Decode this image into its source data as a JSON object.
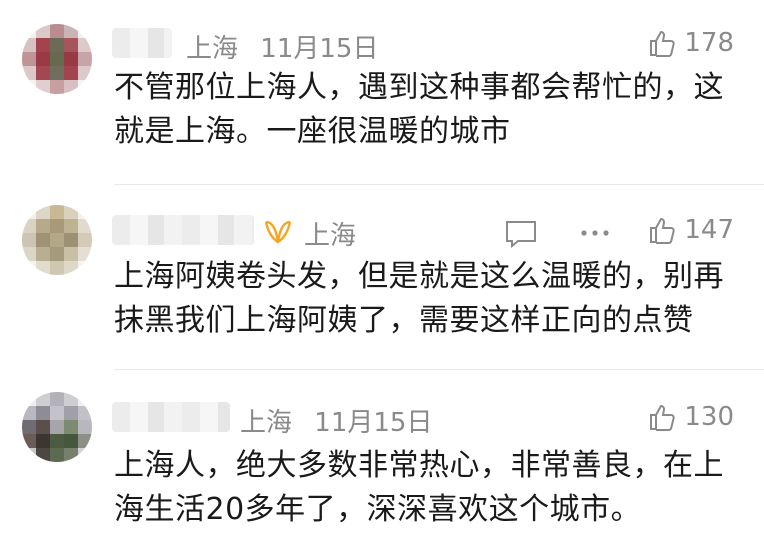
{
  "comments": [
    {
      "location": "上海",
      "date": "11月15日",
      "likes": "178",
      "lines": [
        "不管那位上海人，遇到这种事都会帮忙的，这",
        "就是上海。一座很温暖的城市"
      ]
    },
    {
      "location": "上海",
      "date": "",
      "likes": "147",
      "lines": [
        "上海阿姨卷头发，但是就是这么温暖的，别再",
        "抹黑我们上海阿姨了，需要这样正向的点赞"
      ]
    },
    {
      "location": "上海",
      "date": "11月15日",
      "likes": "130",
      "lines": [
        "上海人，绝大多数非常热心，非常善良，在上",
        "海生活20多年了，深深喜欢这个城市。"
      ]
    }
  ],
  "colors": {
    "meta_gray": "#8a8a8a",
    "badge_orange": "#f5a623",
    "text": "#1a1a1a"
  },
  "icons": [
    "thumbs-up-icon",
    "reply-icon",
    "more-icon",
    "badge-icon"
  ]
}
